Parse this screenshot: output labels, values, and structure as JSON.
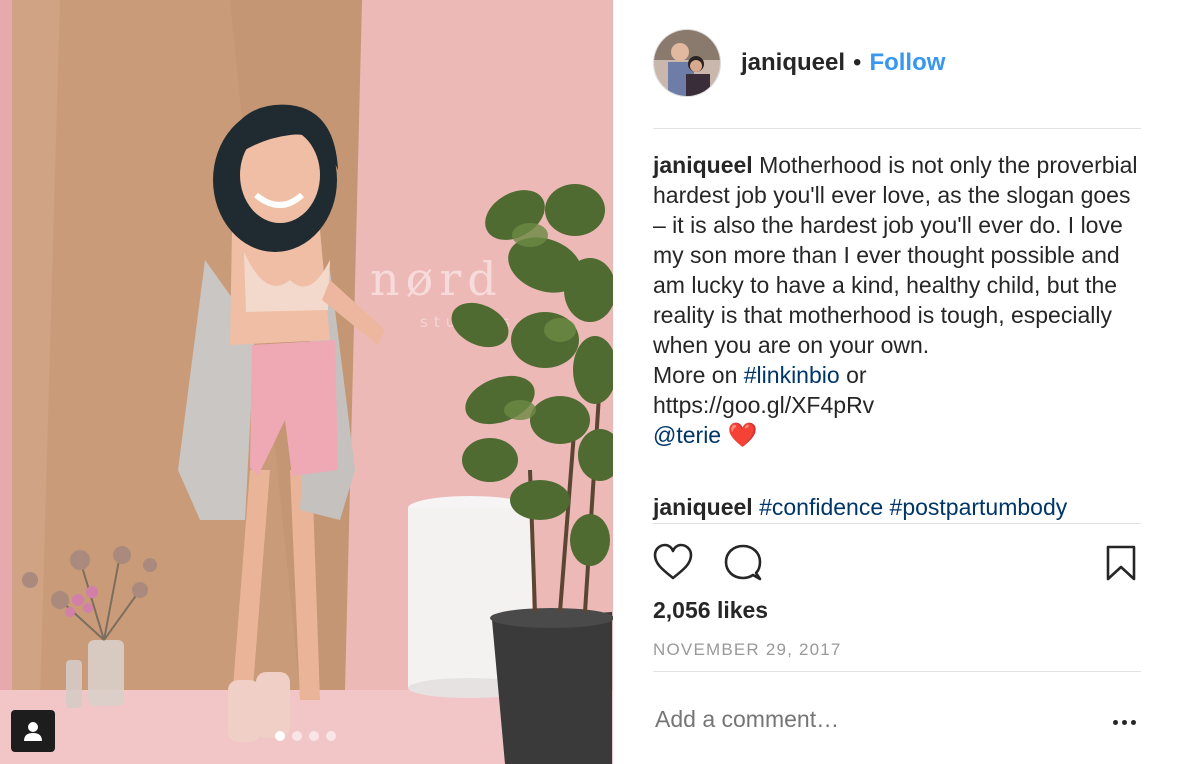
{
  "post": {
    "image_alt": "photo",
    "carousel": {
      "count": 4,
      "active": 1
    }
  },
  "header": {
    "username": "janiqueel",
    "separator": "•",
    "follow_label": "Follow"
  },
  "caption": {
    "username": "janiqueel",
    "text": "Motherhood is not only the proverbial hardest job you'll ever love, as the slogan goes – it is also the hardest job you'll ever do. I love my son more than I ever thought possible and am lucky to have a kind, healthy child, but the reality is that motherhood is tough, especially when you are on your own.",
    "more_on": "More on",
    "hashtag_link": "#linkinbio",
    "or": "or",
    "url": "https://goo.gl/XF4pRv",
    "mention": "@terie",
    "emoji": "❤️"
  },
  "comment_line": {
    "username": "janiqueel",
    "hashtag1": "#confidence",
    "hashtag2": "#postpartumbody"
  },
  "actions": {
    "like_icon": "heart-icon",
    "comment_icon": "comment-bubble-icon",
    "save_icon": "bookmark-icon"
  },
  "likes": "2,056 likes",
  "date": "NOVEMBER 29, 2017",
  "comment_input": {
    "placeholder": "Add a comment…"
  },
  "colors": {
    "follow": "#3897f0",
    "hashtag": "#003569",
    "muted": "#999999"
  }
}
